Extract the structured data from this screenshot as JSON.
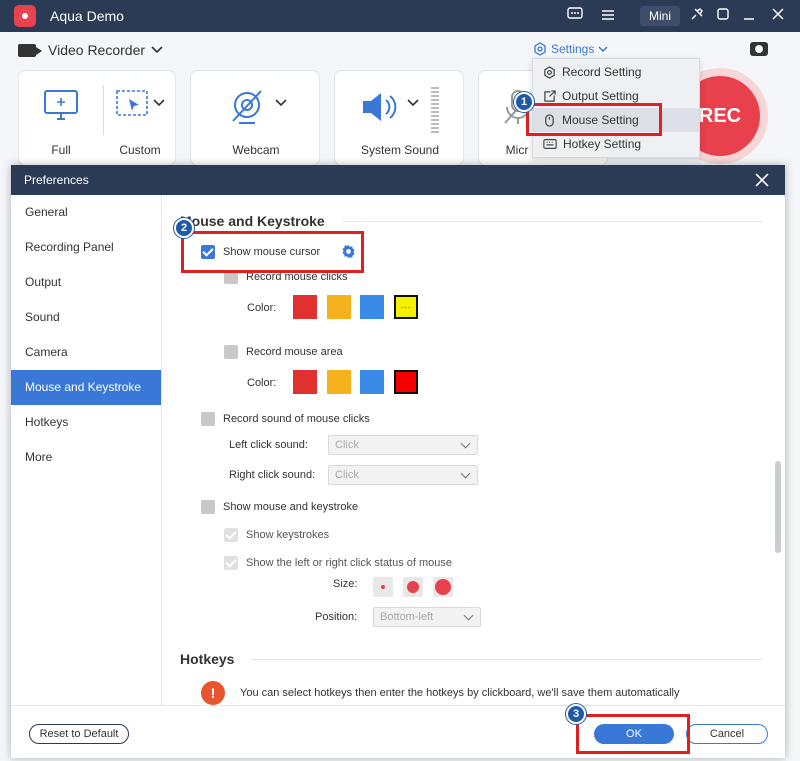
{
  "app": {
    "title": "Aqua Demo",
    "mini_label": "Mini",
    "recorder_label": "Video Recorder",
    "settings_label": "Settings",
    "rec_label": "REC"
  },
  "sources": [
    {
      "label": "Full"
    },
    {
      "label": "Custom"
    },
    {
      "label": "Webcam"
    },
    {
      "label": "System Sound"
    },
    {
      "label": "Micr"
    }
  ],
  "settings_menu": {
    "items": [
      {
        "label": "Record Setting",
        "icon": "gear-icon"
      },
      {
        "label": "Output Setting",
        "icon": "export-icon"
      },
      {
        "label": "Mouse Setting",
        "icon": "mouse-icon"
      },
      {
        "label": "Hotkey Setting",
        "icon": "keyboard-icon"
      }
    ]
  },
  "preferences": {
    "title": "Preferences",
    "nav": [
      {
        "label": "General"
      },
      {
        "label": "Recording Panel"
      },
      {
        "label": "Output"
      },
      {
        "label": "Sound"
      },
      {
        "label": "Camera"
      },
      {
        "label": "Mouse and Keystroke"
      },
      {
        "label": "Hotkeys"
      },
      {
        "label": "More"
      }
    ],
    "active_nav": "Mouse and Keystroke",
    "mouse": {
      "section_title": "Mouse and Keystroke",
      "show_cursor": "Show mouse cursor",
      "record_clicks": "Record mouse clicks",
      "record_area": "Record mouse area",
      "color_label": "Color:",
      "click_colors": [
        "#e03030",
        "#f5b21c",
        "#3a8ae8",
        "#f5f000"
      ],
      "area_colors": [
        "#e03030",
        "#f5b21c",
        "#3a8ae8",
        "#f50000"
      ],
      "swatch_more": "...",
      "record_sound": "Record sound of mouse clicks",
      "left_click_label": "Left click sound:",
      "right_click_label": "Right click sound:",
      "left_click_value": "Click",
      "right_click_value": "Click",
      "show_mouse_keystroke": "Show mouse and keystroke",
      "show_keystrokes": "Show keystrokes",
      "show_click_status": "Show the left or right click status of mouse",
      "size_label": "Size:",
      "position_label": "Position:",
      "position_value": "Bottom-left"
    },
    "hotkeys": {
      "section_title": "Hotkeys",
      "notice": "You can select hotkeys then enter the hotkeys by clickboard, we'll save them automatically"
    },
    "footer": {
      "reset": "Reset to Default",
      "ok": "OK",
      "cancel": "Cancel"
    }
  },
  "steps": [
    "1",
    "2",
    "3"
  ]
}
